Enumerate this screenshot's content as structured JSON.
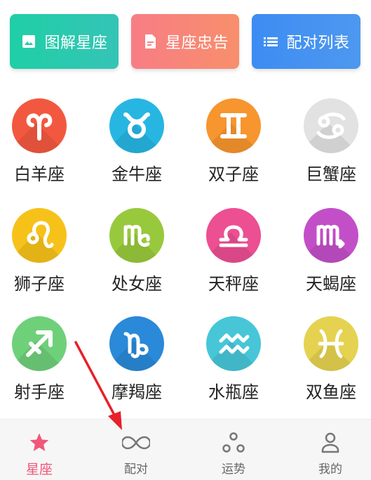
{
  "top_buttons": [
    {
      "label": "图解星座",
      "icon": "image-icon",
      "color": "#1fcfa6"
    },
    {
      "label": "星座忠告",
      "icon": "document-icon",
      "color": "#f87d85"
    },
    {
      "label": "配对列表",
      "icon": "list-icon",
      "color": "#3d8cf3"
    }
  ],
  "signs": [
    {
      "label": "白羊座",
      "icon": "aries-icon",
      "color": "#f2583f"
    },
    {
      "label": "金牛座",
      "icon": "taurus-icon",
      "color": "#27b6e2"
    },
    {
      "label": "双子座",
      "icon": "gemini-icon",
      "color": "#f7952e"
    },
    {
      "label": "巨蟹座",
      "icon": "cancer-icon",
      "color": "#e2e2e2"
    },
    {
      "label": "狮子座",
      "icon": "leo-icon",
      "color": "#f6c21a"
    },
    {
      "label": "处女座",
      "icon": "virgo-icon",
      "color": "#98c93c"
    },
    {
      "label": "天秤座",
      "icon": "libra-icon",
      "color": "#ec4f92"
    },
    {
      "label": "天蝎座",
      "icon": "scorpio-icon",
      "color": "#c34fc8"
    },
    {
      "label": "射手座",
      "icon": "sagittarius-icon",
      "color": "#6fd07a"
    },
    {
      "label": "摩羯座",
      "icon": "capricorn-icon",
      "color": "#2a89d8"
    },
    {
      "label": "水瓶座",
      "icon": "aquarius-icon",
      "color": "#47c6d8"
    },
    {
      "label": "双鱼座",
      "icon": "pisces-icon",
      "color": "#e5d250"
    }
  ],
  "bottom_nav": [
    {
      "label": "星座",
      "icon": "star-icon",
      "active": true
    },
    {
      "label": "配对",
      "icon": "infinity-icon",
      "active": false
    },
    {
      "label": "运势",
      "icon": "three-dots-icon",
      "active": false
    },
    {
      "label": "我的",
      "icon": "person-icon",
      "active": false
    }
  ],
  "colors": {
    "active": "#f0577a",
    "inactive": "#777777",
    "annotation_arrow": "#e8202a"
  }
}
